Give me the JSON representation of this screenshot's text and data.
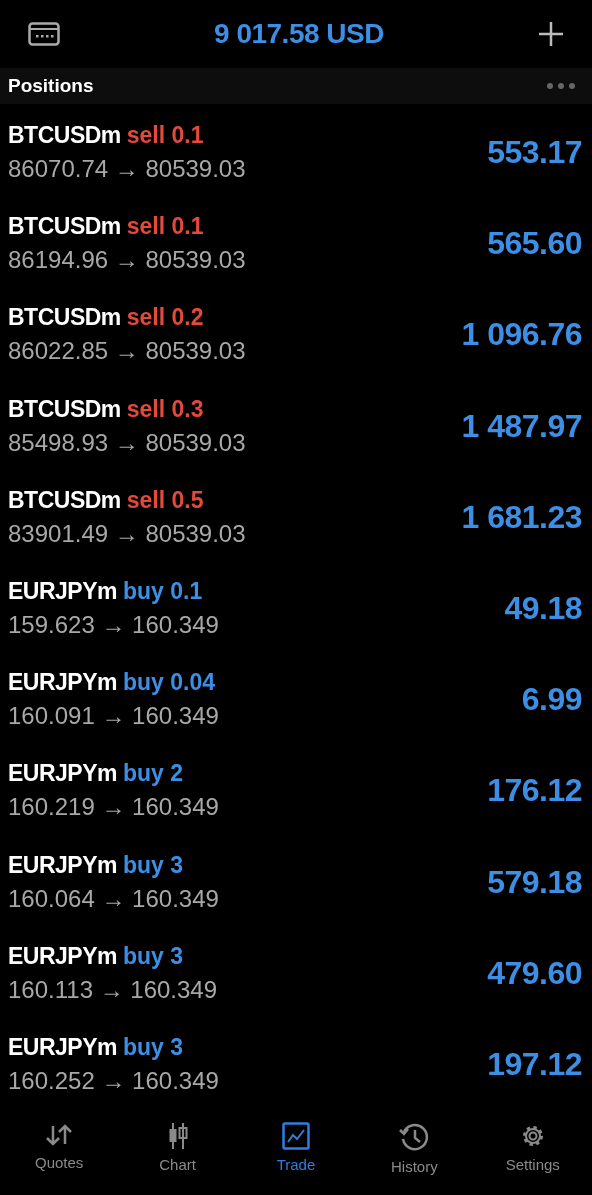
{
  "header": {
    "balance": "9 017.58 USD"
  },
  "section": {
    "title": "Positions"
  },
  "positions": [
    {
      "symbol": "BTCUSDm",
      "kind": "sell",
      "side": "sell",
      "volume": "0.1",
      "open": "86070.74",
      "arrow": "→",
      "current": "80539.03",
      "profit": "553.17"
    },
    {
      "symbol": "BTCUSDm",
      "kind": "sell",
      "side": "sell",
      "volume": "0.1",
      "open": "86194.96",
      "arrow": "→",
      "current": "80539.03",
      "profit": "565.60"
    },
    {
      "symbol": "BTCUSDm",
      "kind": "sell",
      "side": "sell",
      "volume": "0.2",
      "open": "86022.85",
      "arrow": "→",
      "current": "80539.03",
      "profit": "1 096.76"
    },
    {
      "symbol": "BTCUSDm",
      "kind": "sell",
      "side": "sell",
      "volume": "0.3",
      "open": "85498.93",
      "arrow": "→",
      "current": "80539.03",
      "profit": "1 487.97"
    },
    {
      "symbol": "BTCUSDm",
      "kind": "sell",
      "side": "sell",
      "volume": "0.5",
      "open": "83901.49",
      "arrow": "→",
      "current": "80539.03",
      "profit": "1 681.23"
    },
    {
      "symbol": "EURJPYm",
      "kind": "buy",
      "side": "buy",
      "volume": "0.1",
      "open": "159.623",
      "arrow": "→",
      "current": "160.349",
      "profit": "49.18"
    },
    {
      "symbol": "EURJPYm",
      "kind": "buy",
      "side": "buy",
      "volume": "0.04",
      "open": "160.091",
      "arrow": "→",
      "current": "160.349",
      "profit": "6.99"
    },
    {
      "symbol": "EURJPYm",
      "kind": "buy",
      "side": "buy",
      "volume": "2",
      "open": "160.219",
      "arrow": "→",
      "current": "160.349",
      "profit": "176.12"
    },
    {
      "symbol": "EURJPYm",
      "kind": "buy",
      "side": "buy",
      "volume": "3",
      "open": "160.064",
      "arrow": "→",
      "current": "160.349",
      "profit": "579.18"
    },
    {
      "symbol": "EURJPYm",
      "kind": "buy",
      "side": "buy",
      "volume": "3",
      "open": "160.113",
      "arrow": "→",
      "current": "160.349",
      "profit": "479.60"
    },
    {
      "symbol": "EURJPYm",
      "kind": "buy",
      "side": "buy",
      "volume": "3",
      "open": "160.252",
      "arrow": "→",
      "current": "160.349",
      "profit": "197.12"
    }
  ],
  "tabs": [
    {
      "label": "Quotes",
      "kind": "quotes",
      "selected": false
    },
    {
      "label": "Chart",
      "kind": "chart",
      "selected": false
    },
    {
      "label": "Trade",
      "kind": "trade",
      "selected": true
    },
    {
      "label": "History",
      "kind": "history",
      "selected": false
    },
    {
      "label": "Settings",
      "kind": "settings",
      "selected": false
    }
  ]
}
